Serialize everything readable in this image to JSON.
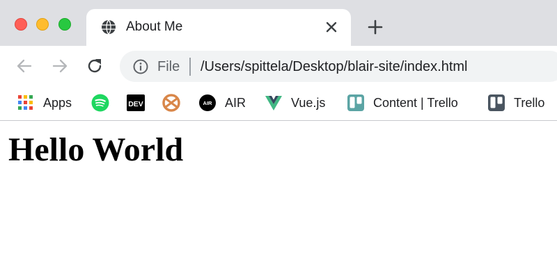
{
  "window": {
    "controls": [
      "close",
      "minimize",
      "zoom"
    ]
  },
  "tab": {
    "title": "About Me",
    "icon": "globe-icon"
  },
  "toolbar": {
    "omnibox": {
      "security_label": "File",
      "url": "/Users/spittela/Desktop/blair-site/index.html"
    }
  },
  "bookmarks": [
    {
      "label": "Apps",
      "icon": "apps-grid-icon"
    },
    {
      "label": "",
      "icon": "spotify-icon"
    },
    {
      "label": "",
      "icon": "dev-icon",
      "icon_text": "DEV"
    },
    {
      "label": "",
      "icon": "pretzel-icon"
    },
    {
      "label": "AIR",
      "icon": "air-icon",
      "icon_text": "AIR"
    },
    {
      "label": "Vue.js",
      "icon": "vue-icon"
    },
    {
      "label": "Content | Trello",
      "icon": "trello-content-icon"
    },
    {
      "label": "Trello",
      "icon": "trello-icon"
    }
  ],
  "page": {
    "heading": "Hello World"
  },
  "colors": {
    "tabstrip_bg": "#dedfe3",
    "close": "#ff5f57",
    "minimize": "#febc2e",
    "zoom": "#28c840",
    "spotify": "#1ed760",
    "vue_green": "#41b883",
    "vue_dark": "#35495e",
    "trello_blue": "#0079bf"
  }
}
